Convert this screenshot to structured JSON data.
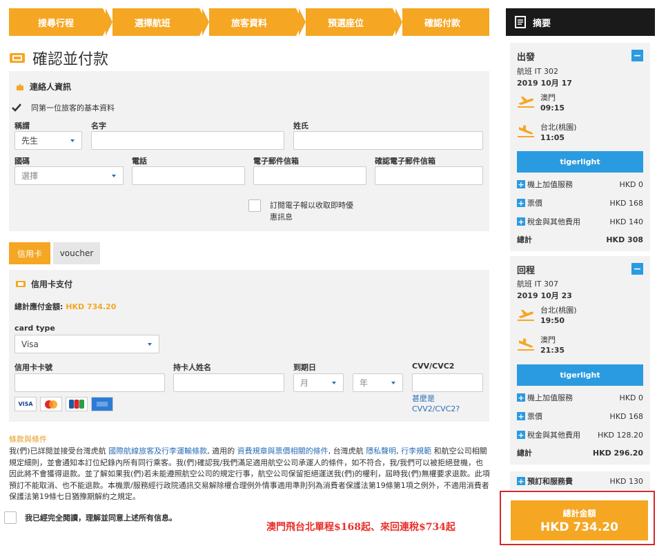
{
  "steps": [
    "搜尋行程",
    "選擇航班",
    "旅客資料",
    "預選座位",
    "確認付款"
  ],
  "page_title": "確認並付款",
  "contact": {
    "heading": "連絡人資訊",
    "same_as_first": "同第一位旅客的基本資料",
    "title_label": "稱謂",
    "title_value": "先生",
    "first_name_label": "名字",
    "last_name_label": "姓氏",
    "country_code_label": "國碼",
    "country_code_placeholder": "選擇",
    "phone_label": "電話",
    "email_label": "電子郵件信箱",
    "confirm_email_label": "確認電子郵件信箱",
    "newsletter_line1": "訂閱電子報以收取即時優",
    "newsletter_line2": "惠訊息"
  },
  "payment_tabs": [
    "信用卡",
    "voucher"
  ],
  "card_payment": {
    "heading": "信用卡支付",
    "total_label": "總計應付金額:",
    "total_value": "HKD 734.20",
    "card_type_label": "card type",
    "card_type_value": "Visa",
    "card_number_label": "信用卡卡號",
    "holder_label": "持卡人姓名",
    "expiry_label": "到期日",
    "month_placeholder": "月",
    "year_placeholder": "年",
    "cvv_label": "CVV/CVC2",
    "cvv_help_line1": "甚麼是",
    "cvv_help_line2": "CVV2/CVC2?",
    "card_logos": [
      "VISA",
      "MC",
      "JCB",
      "AMEX"
    ]
  },
  "terms": {
    "title": "條款與條件",
    "p1_a": "我(們)已詳閱並接受台灣虎航 ",
    "p1_link1": "國際航線旅客及行李運輸條款",
    "p1_b": ", 適用的 ",
    "p1_link2": "資費規章與票價相關的條件",
    "p1_c": ", 台灣虎航 ",
    "p1_link3": "隱私聲明",
    "p1_d": ", ",
    "p1_link4": "行李規範",
    "p1_e": " 和航空公司相關規定細則，並會通知本訂位紀錄內所有同行乘客。我(們)確認我/我們滿足適用航空公司承運人的條件，如不符合，我/我們可以被拒絕登機，也因此將不會獲得退款。並了解如果我(們)若未能遵照航空公司的規定行事，航空公司保留拒絕運送我(們)的權利，屆時我(們)無權要求退款。此項預訂不能取消、也不能退款。本機票/服務經行政院通訊交易解除權合理例外情事適用準則列為消費者保護法第19條第1項之例外，不適用消費者保護法第19條七日猶豫期解約之規定。",
    "agree": "我已經完全閱讀，理解並同意上述所有信息。"
  },
  "promo_text": "澳門飛台北單程$168起、來回連稅$734起",
  "summary": {
    "heading": "摘要",
    "outbound": {
      "title": "出發",
      "flight": "航班 IT 302",
      "date": "2019 10月 17",
      "from_city": "澳門",
      "from_time": "09:15",
      "to_city": "台北(桃園)",
      "to_time": "11:05",
      "fare": "tigerlight",
      "rows": [
        {
          "label": "機上加值服務",
          "amount": "HKD 0"
        },
        {
          "label": "票價",
          "amount": "HKD 168"
        },
        {
          "label": "稅金與其他費用",
          "amount": "HKD 140"
        }
      ],
      "total_label": "總計",
      "total_amount": "HKD 308"
    },
    "inbound": {
      "title": "回程",
      "flight": "航班 IT 307",
      "date": "2019 10月 23",
      "from_city": "台北(桃園)",
      "from_time": "19:50",
      "to_city": "澳門",
      "to_time": "21:35",
      "fare": "tigerlight",
      "rows": [
        {
          "label": "機上加值服務",
          "amount": "HKD 0"
        },
        {
          "label": "票價",
          "amount": "HKD 168"
        },
        {
          "label": "稅金與其他費用",
          "amount": "HKD 128.20"
        }
      ],
      "total_label": "總計",
      "total_amount": "HKD 296.20"
    },
    "booking_fee_label": "預訂和服務費",
    "booking_fee_amount": "HKD 130",
    "grand_label": "總計金額",
    "grand_amount": "HKD 734.20"
  },
  "colors": {
    "accent": "#f5a623",
    "link": "#2a6db5",
    "fare_blue": "#2a9be0",
    "promo_red": "#e8302a",
    "highlight_border": "#d6262b"
  }
}
